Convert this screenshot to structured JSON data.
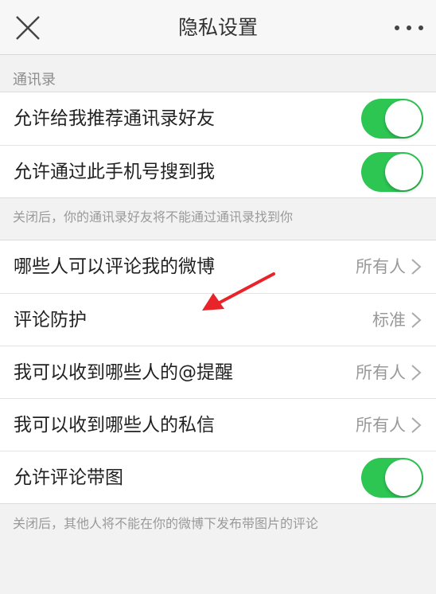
{
  "header": {
    "title": "隐私设置",
    "close_icon": "close-icon",
    "more_icon": "more-dots-icon"
  },
  "contacts_section": {
    "label": "通讯录",
    "items": [
      {
        "label": "允许给我推荐通讯录好友",
        "toggle_on": true
      },
      {
        "label": "允许通过此手机号搜到我",
        "toggle_on": true
      }
    ],
    "note": "关闭后，你的通讯录好友将不能通过通讯录找到你"
  },
  "interaction_section": {
    "items": [
      {
        "label": "哪些人可以评论我的微博",
        "value": "所有人"
      },
      {
        "label": "评论防护",
        "value": "标准"
      },
      {
        "label": "我可以收到哪些人的@提醒",
        "value": "所有人"
      },
      {
        "label": "我可以收到哪些人的私信",
        "value": "所有人"
      },
      {
        "label": "允许评论带图",
        "toggle_on": true
      }
    ],
    "note": "关闭后，其他人将不能在你的微博下发布带图片的评论"
  },
  "colors": {
    "toggle_on": "#2dc653",
    "annotation_arrow": "#e8232a"
  }
}
